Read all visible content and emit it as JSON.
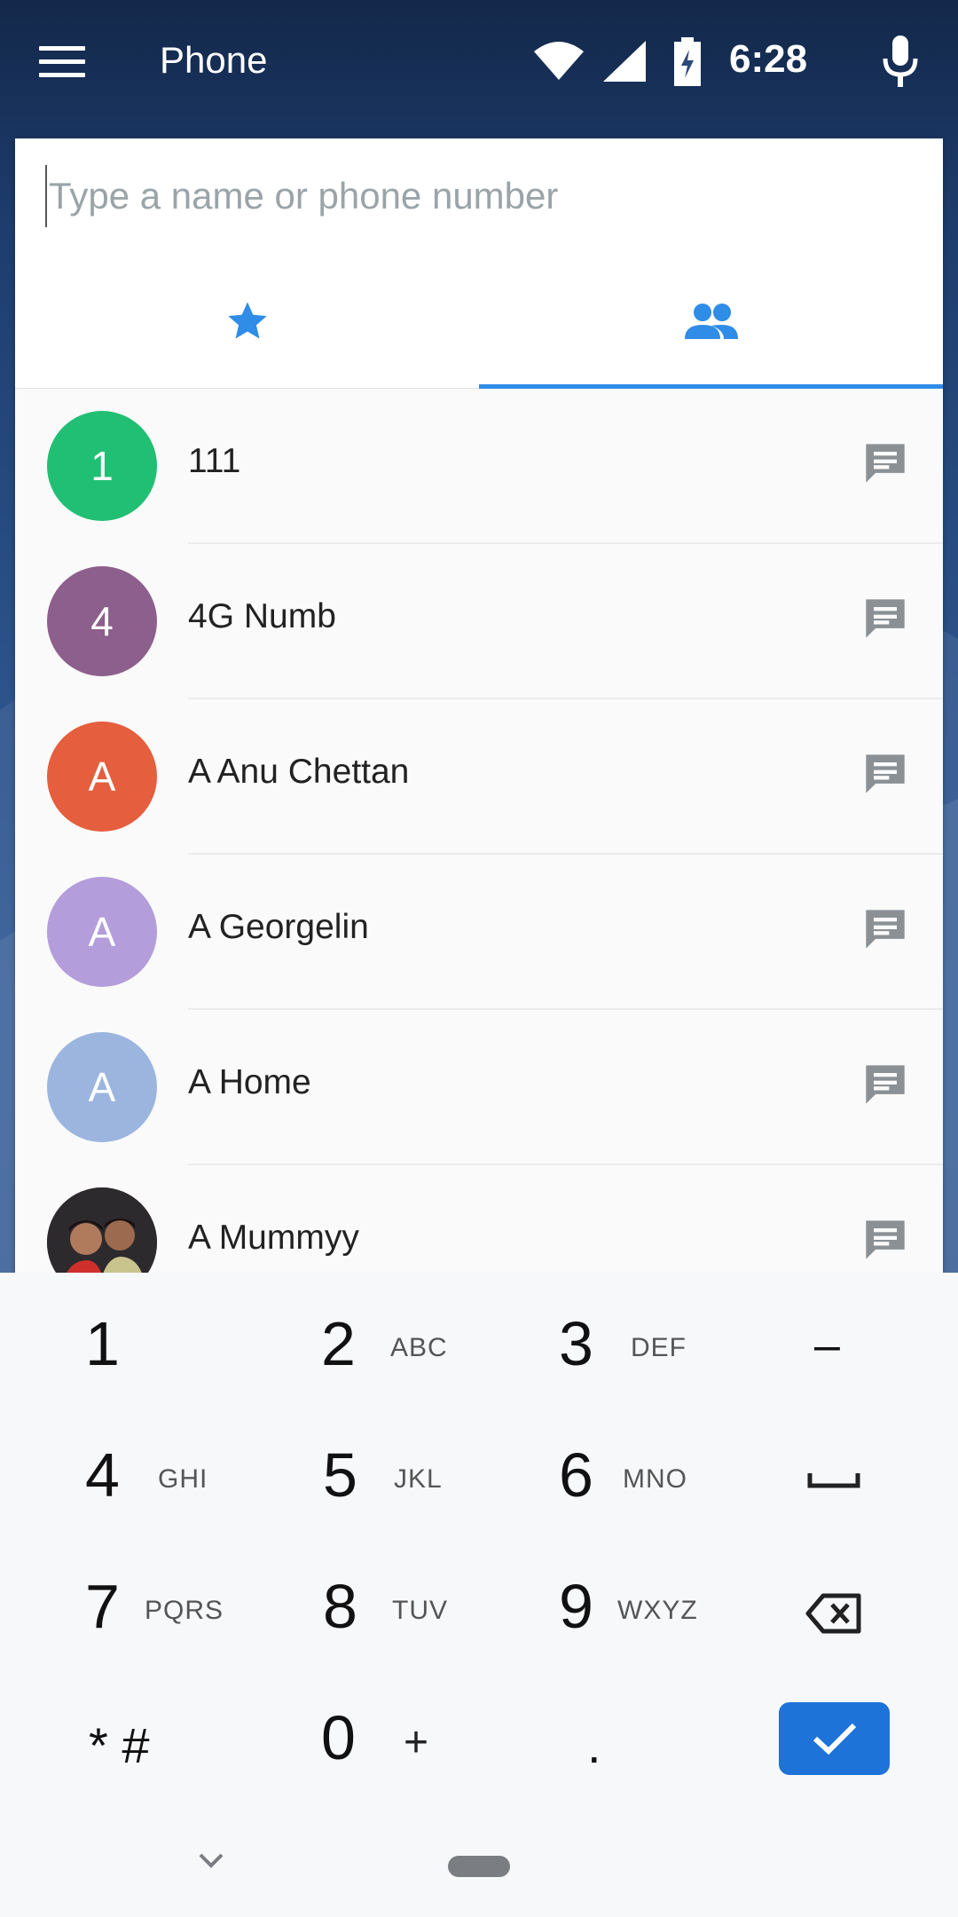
{
  "app": {
    "title": "Phone",
    "clock": "6:28"
  },
  "icons": {
    "menu": "menu-icon",
    "wifi": "wifi-icon",
    "signal": "cell-signal-icon",
    "battery": "battery-charging-icon",
    "mic": "microphone-icon",
    "star": "star-icon",
    "contacts": "people-icon",
    "message": "message-icon"
  },
  "search": {
    "placeholder": "Type a name or phone number"
  },
  "colors": {
    "accent": "#2f8ce7",
    "confirm": "#1e73d9"
  },
  "contacts": [
    {
      "initial": "1",
      "name": "111",
      "color": "#21bf73"
    },
    {
      "initial": "4",
      "name": "4G Numb",
      "color": "#8d5f8c"
    },
    {
      "initial": "A",
      "name": "A Anu Chettan",
      "color": "#e55e3e"
    },
    {
      "initial": "A",
      "name": "A Georgelin",
      "color": "#b39ddb"
    },
    {
      "initial": "A",
      "name": "A Home",
      "color": "#9bb5de"
    },
    {
      "initial": "",
      "name": "A Mummyy",
      "color": "#3a2a2a",
      "photo": true
    }
  ],
  "dialpad": {
    "keys": [
      {
        "digit": "1",
        "letters": ""
      },
      {
        "digit": "2",
        "letters": "ABC"
      },
      {
        "digit": "3",
        "letters": "DEF"
      },
      {
        "digit": "4",
        "letters": "GHI"
      },
      {
        "digit": "5",
        "letters": "JKL"
      },
      {
        "digit": "6",
        "letters": "MNO"
      },
      {
        "digit": "7",
        "letters": "PQRS"
      },
      {
        "digit": "8",
        "letters": "TUV"
      },
      {
        "digit": "9",
        "letters": "WXYZ"
      }
    ],
    "star_hash": "* #",
    "zero": "0",
    "plus": "+",
    "dot": ".",
    "dash": "–"
  }
}
